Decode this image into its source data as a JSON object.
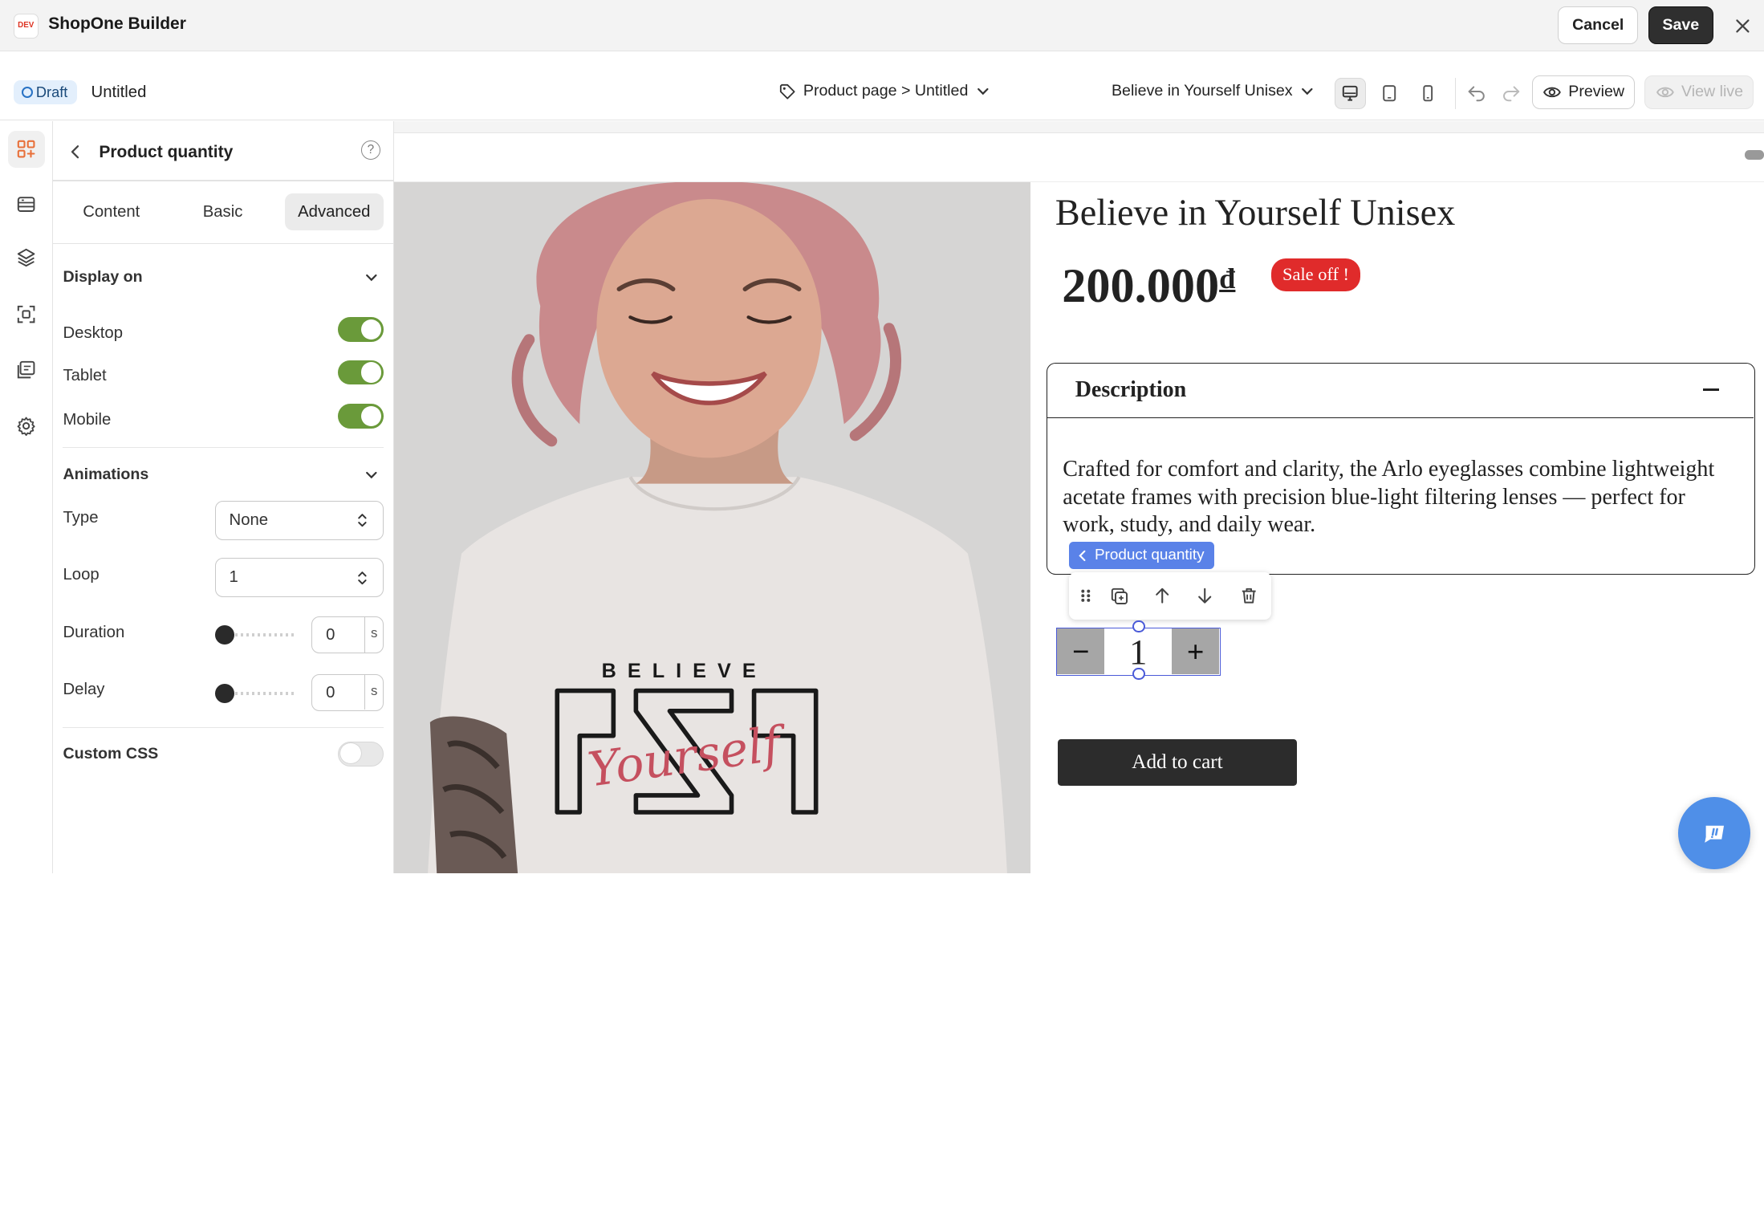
{
  "app": {
    "logo_text": "DEV",
    "title": "ShopOne Builder",
    "cancel_label": "Cancel",
    "save_label": "Save"
  },
  "subbar": {
    "status": "Draft",
    "doc_name": "Untitled",
    "page_path": "Product page > Untitled",
    "product": "Believe in Yourself Unisex",
    "preview_label": "Preview",
    "view_live_label": "View live",
    "active_device": "desktop"
  },
  "rail": {
    "items": [
      "elements-icon",
      "sections-icon",
      "layers-icon",
      "templates-icon",
      "pages-icon",
      "settings-icon"
    ],
    "active": "elements-icon"
  },
  "panel": {
    "title": "Product quantity",
    "tabs": [
      {
        "label": "Content",
        "active": false
      },
      {
        "label": "Basic",
        "active": false
      },
      {
        "label": "Advanced",
        "active": true
      }
    ],
    "display_on": {
      "title": "Display on",
      "desktop": {
        "label": "Desktop",
        "on": true
      },
      "tablet": {
        "label": "Tablet",
        "on": true
      },
      "mobile": {
        "label": "Mobile",
        "on": true
      }
    },
    "animations": {
      "title": "Animations",
      "type_label": "Type",
      "type_value": "None",
      "loop_label": "Loop",
      "loop_value": "1",
      "duration_label": "Duration",
      "duration_value": "0",
      "delay_label": "Delay",
      "delay_value": "0",
      "unit": "s"
    },
    "custom_css": {
      "label": "Custom CSS",
      "on": false
    }
  },
  "product": {
    "title": "Believe in Yourself Unisex",
    "price": "200.000",
    "currency": "đ",
    "sale_badge": "Sale off !",
    "shirt_text": "BELIEVE",
    "shirt_script": "Yourself",
    "description_title": "Description",
    "description": "Crafted for comfort and clarity, the Arlo eyeglasses combine lightweight acetate frames with precision blue-light filtering lenses — perfect for work, study, and daily wear.",
    "quantity_label": "Product quantity",
    "quantity_value": "1",
    "quantity_minus": "−",
    "quantity_plus": "+",
    "add_to_cart": "Add to cart"
  },
  "colors": {
    "accent_green": "#6a9a3a",
    "selection_blue": "#4a5ad8",
    "sale_red": "#e02b2b",
    "draft_blue": "#2872c4"
  }
}
